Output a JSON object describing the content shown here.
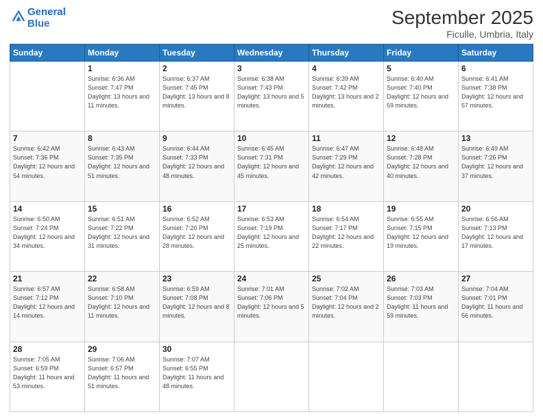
{
  "logo": {
    "line1": "General",
    "line2": "Blue"
  },
  "header": {
    "month": "September 2025",
    "location": "Ficulle, Umbria, Italy"
  },
  "weekdays": [
    "Sunday",
    "Monday",
    "Tuesday",
    "Wednesday",
    "Thursday",
    "Friday",
    "Saturday"
  ],
  "weeks": [
    [
      {
        "day": "",
        "sunrise": "",
        "sunset": "",
        "daylight": ""
      },
      {
        "day": "1",
        "sunrise": "Sunrise: 6:36 AM",
        "sunset": "Sunset: 7:47 PM",
        "daylight": "Daylight: 13 hours and 11 minutes."
      },
      {
        "day": "2",
        "sunrise": "Sunrise: 6:37 AM",
        "sunset": "Sunset: 7:45 PM",
        "daylight": "Daylight: 13 hours and 8 minutes."
      },
      {
        "day": "3",
        "sunrise": "Sunrise: 6:38 AM",
        "sunset": "Sunset: 7:43 PM",
        "daylight": "Daylight: 13 hours and 5 minutes."
      },
      {
        "day": "4",
        "sunrise": "Sunrise: 6:39 AM",
        "sunset": "Sunset: 7:42 PM",
        "daylight": "Daylight: 13 hours and 2 minutes."
      },
      {
        "day": "5",
        "sunrise": "Sunrise: 6:40 AM",
        "sunset": "Sunset: 7:40 PM",
        "daylight": "Daylight: 12 hours and 59 minutes."
      },
      {
        "day": "6",
        "sunrise": "Sunrise: 6:41 AM",
        "sunset": "Sunset: 7:38 PM",
        "daylight": "Daylight: 12 hours and 57 minutes."
      }
    ],
    [
      {
        "day": "7",
        "sunrise": "Sunrise: 6:42 AM",
        "sunset": "Sunset: 7:36 PM",
        "daylight": "Daylight: 12 hours and 54 minutes."
      },
      {
        "day": "8",
        "sunrise": "Sunrise: 6:43 AM",
        "sunset": "Sunset: 7:35 PM",
        "daylight": "Daylight: 12 hours and 51 minutes."
      },
      {
        "day": "9",
        "sunrise": "Sunrise: 6:44 AM",
        "sunset": "Sunset: 7:33 PM",
        "daylight": "Daylight: 12 hours and 48 minutes."
      },
      {
        "day": "10",
        "sunrise": "Sunrise: 6:45 AM",
        "sunset": "Sunset: 7:31 PM",
        "daylight": "Daylight: 12 hours and 45 minutes."
      },
      {
        "day": "11",
        "sunrise": "Sunrise: 6:47 AM",
        "sunset": "Sunset: 7:29 PM",
        "daylight": "Daylight: 12 hours and 42 minutes."
      },
      {
        "day": "12",
        "sunrise": "Sunrise: 6:48 AM",
        "sunset": "Sunset: 7:28 PM",
        "daylight": "Daylight: 12 hours and 40 minutes."
      },
      {
        "day": "13",
        "sunrise": "Sunrise: 6:49 AM",
        "sunset": "Sunset: 7:26 PM",
        "daylight": "Daylight: 12 hours and 37 minutes."
      }
    ],
    [
      {
        "day": "14",
        "sunrise": "Sunrise: 6:50 AM",
        "sunset": "Sunset: 7:24 PM",
        "daylight": "Daylight: 12 hours and 34 minutes."
      },
      {
        "day": "15",
        "sunrise": "Sunrise: 6:51 AM",
        "sunset": "Sunset: 7:22 PM",
        "daylight": "Daylight: 12 hours and 31 minutes."
      },
      {
        "day": "16",
        "sunrise": "Sunrise: 6:52 AM",
        "sunset": "Sunset: 7:20 PM",
        "daylight": "Daylight: 12 hours and 28 minutes."
      },
      {
        "day": "17",
        "sunrise": "Sunrise: 6:53 AM",
        "sunset": "Sunset: 7:19 PM",
        "daylight": "Daylight: 12 hours and 25 minutes."
      },
      {
        "day": "18",
        "sunrise": "Sunrise: 6:54 AM",
        "sunset": "Sunset: 7:17 PM",
        "daylight": "Daylight: 12 hours and 22 minutes."
      },
      {
        "day": "19",
        "sunrise": "Sunrise: 6:55 AM",
        "sunset": "Sunset: 7:15 PM",
        "daylight": "Daylight: 12 hours and 19 minutes."
      },
      {
        "day": "20",
        "sunrise": "Sunrise: 6:56 AM",
        "sunset": "Sunset: 7:13 PM",
        "daylight": "Daylight: 12 hours and 17 minutes."
      }
    ],
    [
      {
        "day": "21",
        "sunrise": "Sunrise: 6:57 AM",
        "sunset": "Sunset: 7:12 PM",
        "daylight": "Daylight: 12 hours and 14 minutes."
      },
      {
        "day": "22",
        "sunrise": "Sunrise: 6:58 AM",
        "sunset": "Sunset: 7:10 PM",
        "daylight": "Daylight: 12 hours and 11 minutes."
      },
      {
        "day": "23",
        "sunrise": "Sunrise: 6:59 AM",
        "sunset": "Sunset: 7:08 PM",
        "daylight": "Daylight: 12 hours and 8 minutes."
      },
      {
        "day": "24",
        "sunrise": "Sunrise: 7:01 AM",
        "sunset": "Sunset: 7:06 PM",
        "daylight": "Daylight: 12 hours and 5 minutes."
      },
      {
        "day": "25",
        "sunrise": "Sunrise: 7:02 AM",
        "sunset": "Sunset: 7:04 PM",
        "daylight": "Daylight: 12 hours and 2 minutes."
      },
      {
        "day": "26",
        "sunrise": "Sunrise: 7:03 AM",
        "sunset": "Sunset: 7:03 PM",
        "daylight": "Daylight: 11 hours and 59 minutes."
      },
      {
        "day": "27",
        "sunrise": "Sunrise: 7:04 AM",
        "sunset": "Sunset: 7:01 PM",
        "daylight": "Daylight: 11 hours and 56 minutes."
      }
    ],
    [
      {
        "day": "28",
        "sunrise": "Sunrise: 7:05 AM",
        "sunset": "Sunset: 6:59 PM",
        "daylight": "Daylight: 11 hours and 53 minutes."
      },
      {
        "day": "29",
        "sunrise": "Sunrise: 7:06 AM",
        "sunset": "Sunset: 6:57 PM",
        "daylight": "Daylight: 11 hours and 51 minutes."
      },
      {
        "day": "30",
        "sunrise": "Sunrise: 7:07 AM",
        "sunset": "Sunset: 6:55 PM",
        "daylight": "Daylight: 11 hours and 48 minutes."
      },
      {
        "day": "",
        "sunrise": "",
        "sunset": "",
        "daylight": ""
      },
      {
        "day": "",
        "sunrise": "",
        "sunset": "",
        "daylight": ""
      },
      {
        "day": "",
        "sunrise": "",
        "sunset": "",
        "daylight": ""
      },
      {
        "day": "",
        "sunrise": "",
        "sunset": "",
        "daylight": ""
      }
    ]
  ]
}
